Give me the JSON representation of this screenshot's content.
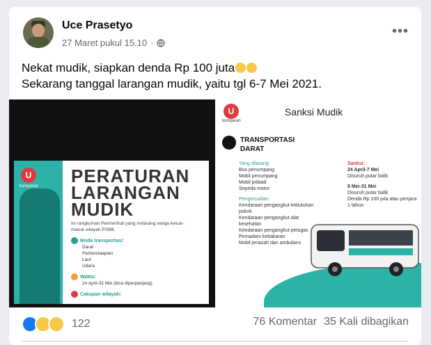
{
  "post": {
    "author": "Uce Prasetyo",
    "timestamp": "27 Maret pukul 15.10",
    "privacy_icon": "globe-icon",
    "line1": "Nekat mudik, siapkan denda Rp 100 juta",
    "line2": "Sekarang tanggal larangan mudik, yaitu tgl 6-7 Mei 2021.",
    "emoji": [
      "crying-face",
      "crying-face"
    ]
  },
  "left_poster": {
    "logo_letter": "U",
    "logo_text": "kumparan",
    "title": "PERATURAN LARANGAN MUDIK",
    "subtitle": "Ini rangkuman Permenhub yang melarang warga keluar-masuk wilayah PSBB.",
    "moda_heading": "Moda transportasi:",
    "moda_items": [
      "Darat",
      "Perkeretaapian",
      "Laut",
      "Udara"
    ],
    "waktu_heading": "Waktu:",
    "waktu_value": "24 April-31 Mei (bisa diperpanjang)",
    "cakupan_heading": "Cakupan wilayah:"
  },
  "right_poster": {
    "logo_letter": "U",
    "logo_text": "kumparan",
    "header": "Sanksi Mudik",
    "title": "TRANSPORTASI DARAT",
    "dilarang_heading": "Yang dilarang:",
    "dilarang_items": [
      "Bus penumpang",
      "Mobil penumpang",
      "Mobil pribadi",
      "Sepeda motor"
    ],
    "pengecualian_heading": "Pengecualian:",
    "pengecualian_items": [
      "Kendaraan pengangkut kebutuhan pokok",
      "Kendaraan pengangkut alat kesehatan",
      "Kendaraan pengangkut petugas",
      "Pemadam kebakaran",
      "Mobil jenazah dan ambulans"
    ],
    "sanksi_heading": "Sanksi:",
    "sanksi_period1": "24 April-7 Mei",
    "sanksi_item1": "Disuruh putar balik",
    "sanksi_period2": "8 Mei-31 Mei",
    "sanksi_item2": "Disuruh putar balik",
    "sanksi_item3": "Denda Rp 100 juta atau penjara 1 tahun"
  },
  "footer": {
    "reaction_count": "122",
    "comments": "76 Komentar",
    "shares": "35 Kali dibagikan",
    "reaction_icons": [
      "like-icon",
      "sad-icon",
      "wow-icon"
    ]
  },
  "colors": {
    "accent_teal": "#2db2a7",
    "brand_red": "#e03a3e",
    "facebook_blue": "#1877f2"
  }
}
